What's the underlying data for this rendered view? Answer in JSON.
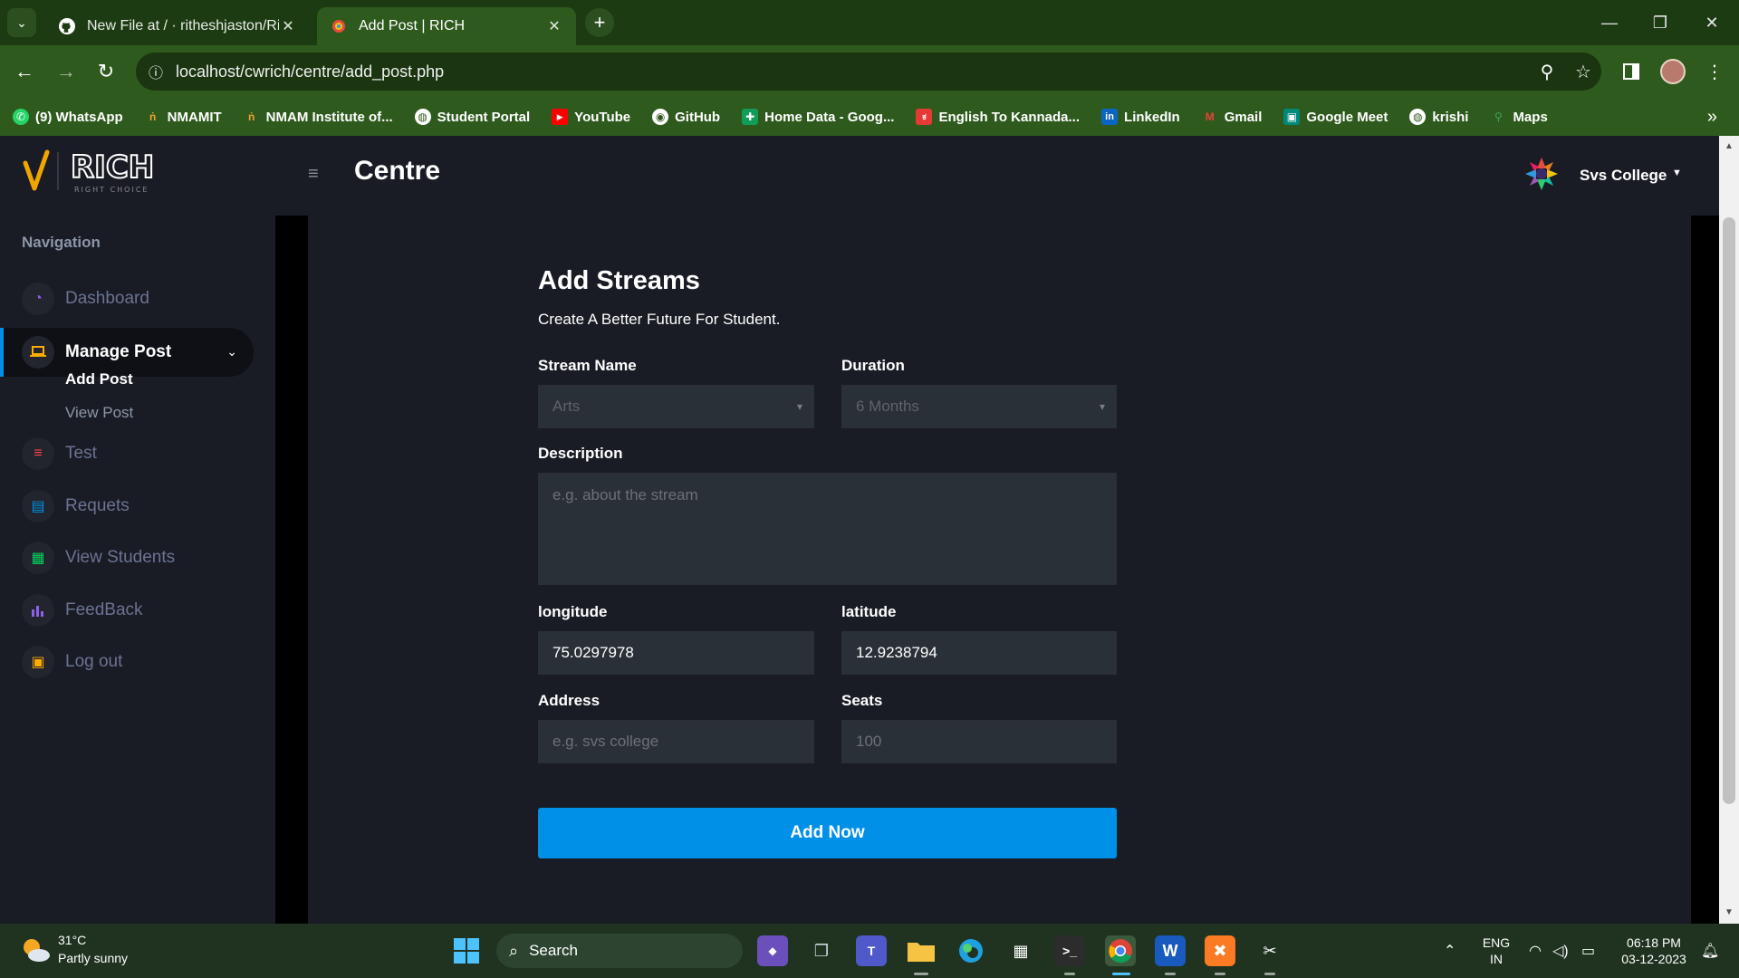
{
  "browser": {
    "tabs": [
      {
        "title": "New File at / · ritheshjaston/Ri",
        "active": false,
        "icon": "github-icon"
      },
      {
        "title": "Add Post | RICH",
        "active": true,
        "icon": "rich-favicon-icon"
      }
    ],
    "url": "localhost/cwrich/centre/add_post.php",
    "bookmarks": [
      {
        "label": "(9) WhatsApp",
        "icon": "whatsapp-icon",
        "color": "#25d366"
      },
      {
        "label": "NMAMIT",
        "icon": "nmamit-icon",
        "color": "#f0a030"
      },
      {
        "label": "NMAM Institute of...",
        "icon": "nmamit-icon",
        "color": "#f0a030"
      },
      {
        "label": "Student Portal",
        "icon": "globe-icon",
        "color": "#ffffff"
      },
      {
        "label": "YouTube",
        "icon": "youtube-icon",
        "color": "#ff0000"
      },
      {
        "label": "GitHub",
        "icon": "github-icon",
        "color": "#ffffff"
      },
      {
        "label": "Home Data - Goog...",
        "icon": "sheets-icon",
        "color": "#0f9d58"
      },
      {
        "label": "English To Kannada...",
        "icon": "kannada-icon",
        "color": "#e53935"
      },
      {
        "label": "LinkedIn",
        "icon": "linkedin-icon",
        "color": "#0a66c2"
      },
      {
        "label": "Gmail",
        "icon": "gmail-icon",
        "color": "#ea4335"
      },
      {
        "label": "Google Meet",
        "icon": "meet-icon",
        "color": "#00897b"
      },
      {
        "label": "krishi",
        "icon": "globe-icon",
        "color": "#ffffff"
      },
      {
        "label": "Maps",
        "icon": "maps-icon",
        "color": "#34a853"
      }
    ]
  },
  "header": {
    "logo_text": "RICH",
    "logo_tagline": "RIGHT CHOICE",
    "title": "Centre",
    "user": "Svs College"
  },
  "sidebar": {
    "heading": "Navigation",
    "items": [
      {
        "label": "Dashboard",
        "icon": "speedometer-icon",
        "color": "#8f5fe8"
      },
      {
        "label": "Manage Post",
        "icon": "laptop-icon",
        "color": "#ffab00",
        "active": true
      },
      {
        "label": "Test",
        "icon": "playlist-icon",
        "color": "#fc424a"
      },
      {
        "label": "Requets",
        "icon": "document-icon",
        "color": "#0090e7"
      },
      {
        "label": "View Students",
        "icon": "table-icon",
        "color": "#00d25b"
      },
      {
        "label": "FeedBack",
        "icon": "chart-bar-icon",
        "color": "#8f5fe8"
      },
      {
        "label": "Log out",
        "icon": "contacts-icon",
        "color": "#ffab00"
      }
    ],
    "subitems": [
      {
        "label": "Add Post",
        "active": true
      },
      {
        "label": "View Post",
        "active": false
      }
    ]
  },
  "form": {
    "title": "Add Streams",
    "subtitle": "Create A Better Future For Student.",
    "stream_label": "Stream Name",
    "stream_value": "Arts",
    "duration_label": "Duration",
    "duration_value": "6 Months",
    "description_label": "Description",
    "description_placeholder": "e.g. about the stream",
    "longitude_label": "longitude",
    "longitude_value": "75.0297978",
    "latitude_label": "latitude",
    "latitude_value": "12.9238794",
    "address_label": "Address",
    "address_placeholder": "e.g. svs college",
    "seats_label": "Seats",
    "seats_placeholder": "100",
    "submit_label": "Add Now"
  },
  "taskbar": {
    "temperature": "31°C",
    "weather": "Partly sunny",
    "search": "Search",
    "lang_top": "ENG",
    "lang_bottom": "IN",
    "time": "06:18 PM",
    "date": "03-12-2023"
  },
  "colors": {
    "accent": "#0090e7",
    "sidebar_bg": "#191c24",
    "chrome_green": "#2f5a1e"
  }
}
